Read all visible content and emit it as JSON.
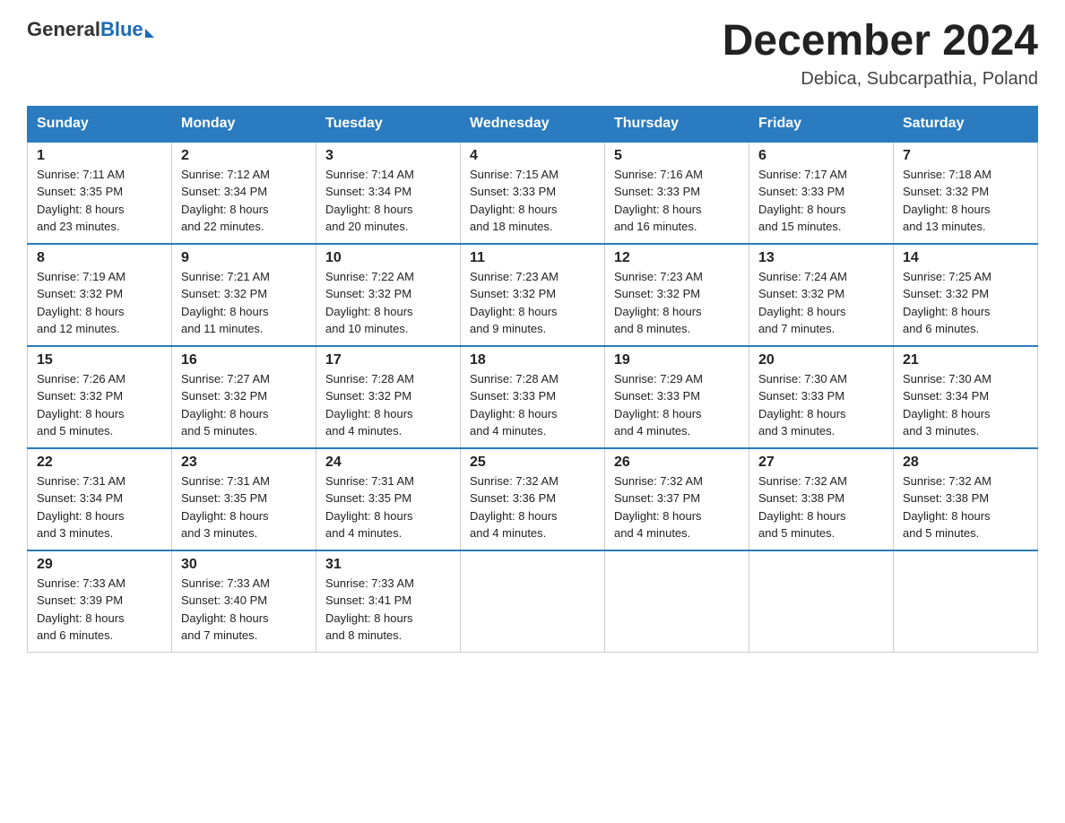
{
  "header": {
    "logo_general": "General",
    "logo_blue": "Blue",
    "title": "December 2024",
    "location": "Debica, Subcarpathia, Poland"
  },
  "weekdays": [
    "Sunday",
    "Monday",
    "Tuesday",
    "Wednesday",
    "Thursday",
    "Friday",
    "Saturday"
  ],
  "weeks": [
    [
      {
        "day": "1",
        "sunrise": "7:11 AM",
        "sunset": "3:35 PM",
        "daylight": "8 hours and 23 minutes."
      },
      {
        "day": "2",
        "sunrise": "7:12 AM",
        "sunset": "3:34 PM",
        "daylight": "8 hours and 22 minutes."
      },
      {
        "day": "3",
        "sunrise": "7:14 AM",
        "sunset": "3:34 PM",
        "daylight": "8 hours and 20 minutes."
      },
      {
        "day": "4",
        "sunrise": "7:15 AM",
        "sunset": "3:33 PM",
        "daylight": "8 hours and 18 minutes."
      },
      {
        "day": "5",
        "sunrise": "7:16 AM",
        "sunset": "3:33 PM",
        "daylight": "8 hours and 16 minutes."
      },
      {
        "day": "6",
        "sunrise": "7:17 AM",
        "sunset": "3:33 PM",
        "daylight": "8 hours and 15 minutes."
      },
      {
        "day": "7",
        "sunrise": "7:18 AM",
        "sunset": "3:32 PM",
        "daylight": "8 hours and 13 minutes."
      }
    ],
    [
      {
        "day": "8",
        "sunrise": "7:19 AM",
        "sunset": "3:32 PM",
        "daylight": "8 hours and 12 minutes."
      },
      {
        "day": "9",
        "sunrise": "7:21 AM",
        "sunset": "3:32 PM",
        "daylight": "8 hours and 11 minutes."
      },
      {
        "day": "10",
        "sunrise": "7:22 AM",
        "sunset": "3:32 PM",
        "daylight": "8 hours and 10 minutes."
      },
      {
        "day": "11",
        "sunrise": "7:23 AM",
        "sunset": "3:32 PM",
        "daylight": "8 hours and 9 minutes."
      },
      {
        "day": "12",
        "sunrise": "7:23 AM",
        "sunset": "3:32 PM",
        "daylight": "8 hours and 8 minutes."
      },
      {
        "day": "13",
        "sunrise": "7:24 AM",
        "sunset": "3:32 PM",
        "daylight": "8 hours and 7 minutes."
      },
      {
        "day": "14",
        "sunrise": "7:25 AM",
        "sunset": "3:32 PM",
        "daylight": "8 hours and 6 minutes."
      }
    ],
    [
      {
        "day": "15",
        "sunrise": "7:26 AM",
        "sunset": "3:32 PM",
        "daylight": "8 hours and 5 minutes."
      },
      {
        "day": "16",
        "sunrise": "7:27 AM",
        "sunset": "3:32 PM",
        "daylight": "8 hours and 5 minutes."
      },
      {
        "day": "17",
        "sunrise": "7:28 AM",
        "sunset": "3:32 PM",
        "daylight": "8 hours and 4 minutes."
      },
      {
        "day": "18",
        "sunrise": "7:28 AM",
        "sunset": "3:33 PM",
        "daylight": "8 hours and 4 minutes."
      },
      {
        "day": "19",
        "sunrise": "7:29 AM",
        "sunset": "3:33 PM",
        "daylight": "8 hours and 4 minutes."
      },
      {
        "day": "20",
        "sunrise": "7:30 AM",
        "sunset": "3:33 PM",
        "daylight": "8 hours and 3 minutes."
      },
      {
        "day": "21",
        "sunrise": "7:30 AM",
        "sunset": "3:34 PM",
        "daylight": "8 hours and 3 minutes."
      }
    ],
    [
      {
        "day": "22",
        "sunrise": "7:31 AM",
        "sunset": "3:34 PM",
        "daylight": "8 hours and 3 minutes."
      },
      {
        "day": "23",
        "sunrise": "7:31 AM",
        "sunset": "3:35 PM",
        "daylight": "8 hours and 3 minutes."
      },
      {
        "day": "24",
        "sunrise": "7:31 AM",
        "sunset": "3:35 PM",
        "daylight": "8 hours and 4 minutes."
      },
      {
        "day": "25",
        "sunrise": "7:32 AM",
        "sunset": "3:36 PM",
        "daylight": "8 hours and 4 minutes."
      },
      {
        "day": "26",
        "sunrise": "7:32 AM",
        "sunset": "3:37 PM",
        "daylight": "8 hours and 4 minutes."
      },
      {
        "day": "27",
        "sunrise": "7:32 AM",
        "sunset": "3:38 PM",
        "daylight": "8 hours and 5 minutes."
      },
      {
        "day": "28",
        "sunrise": "7:32 AM",
        "sunset": "3:38 PM",
        "daylight": "8 hours and 5 minutes."
      }
    ],
    [
      {
        "day": "29",
        "sunrise": "7:33 AM",
        "sunset": "3:39 PM",
        "daylight": "8 hours and 6 minutes."
      },
      {
        "day": "30",
        "sunrise": "7:33 AM",
        "sunset": "3:40 PM",
        "daylight": "8 hours and 7 minutes."
      },
      {
        "day": "31",
        "sunrise": "7:33 AM",
        "sunset": "3:41 PM",
        "daylight": "8 hours and 8 minutes."
      },
      null,
      null,
      null,
      null
    ]
  ],
  "labels": {
    "sunrise": "Sunrise:",
    "sunset": "Sunset:",
    "daylight": "Daylight:"
  }
}
